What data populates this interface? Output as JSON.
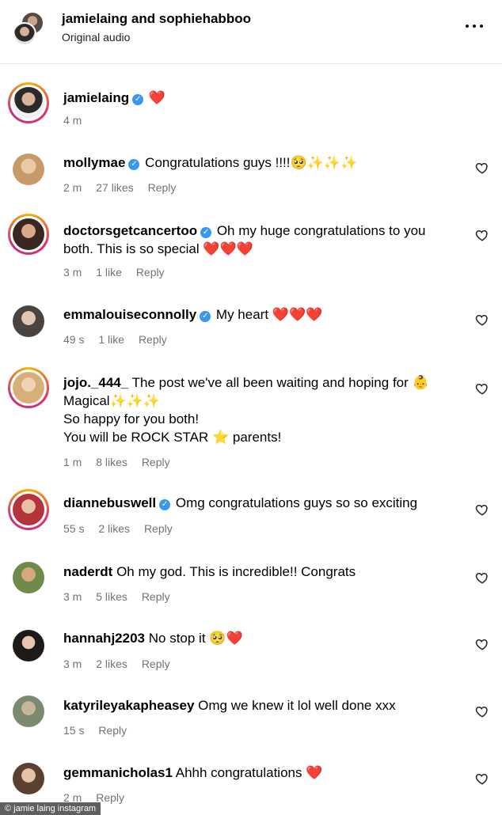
{
  "header": {
    "title": "jamielaing and sophiehabboo",
    "subtitle": "Original audio"
  },
  "comments": [
    {
      "user": "jamielaing",
      "text": "",
      "emoji": "❤️",
      "time": "4 m",
      "likes": "",
      "reply": ""
    },
    {
      "user": "mollymae",
      "text": "Congratulations guys !!!!",
      "emoji": "🥺✨✨✨",
      "time": "2 m",
      "likes": "27 likes",
      "reply": "Reply"
    },
    {
      "user": "doctorsgetcancertoo",
      "text": "Oh my huge congratulations to you both. This is so special",
      "emoji": "❤️❤️❤️",
      "time": "3 m",
      "likes": "1 like",
      "reply": "Reply"
    },
    {
      "user": "emmalouiseconnolly",
      "text": "My heart",
      "emoji": "❤️❤️❤️",
      "time": "49 s",
      "likes": "1 like",
      "reply": "Reply"
    },
    {
      "user": "jojo._444_",
      "text": "The post we've all been waiting and hoping for 👶 Magical✨✨✨",
      "line2": "So happy for you both!",
      "line3": "You will be ROCK STAR ⭐ parents!",
      "time": "1 m",
      "likes": "8 likes",
      "reply": "Reply"
    },
    {
      "user": "diannebuswell",
      "text": "Omg congratulations guys so so exciting",
      "time": "55 s",
      "likes": "2 likes",
      "reply": "Reply"
    },
    {
      "user": "naderdt",
      "text": "Oh my god. This is incredible!! Congrats",
      "time": "3 m",
      "likes": "5 likes",
      "reply": "Reply"
    },
    {
      "user": "hannahj2203",
      "text": "No stop it",
      "emoji": "🥺❤️",
      "time": "3 m",
      "likes": "2 likes",
      "reply": "Reply"
    },
    {
      "user": "katyrileyakapheasey",
      "text": "Omg we knew it lol well done xxx",
      "time": "15 s",
      "likes": "",
      "reply": "Reply"
    },
    {
      "user": "gemmanicholas1",
      "text": "Ahhh congratulations",
      "emoji": "❤️",
      "time": "2 m",
      "likes": "",
      "reply": "Reply"
    }
  ],
  "watermark": "© jamie laing instagram",
  "colors": {
    "verified": "#3897f0",
    "heart": "#e0151f",
    "meta": "#737373"
  }
}
